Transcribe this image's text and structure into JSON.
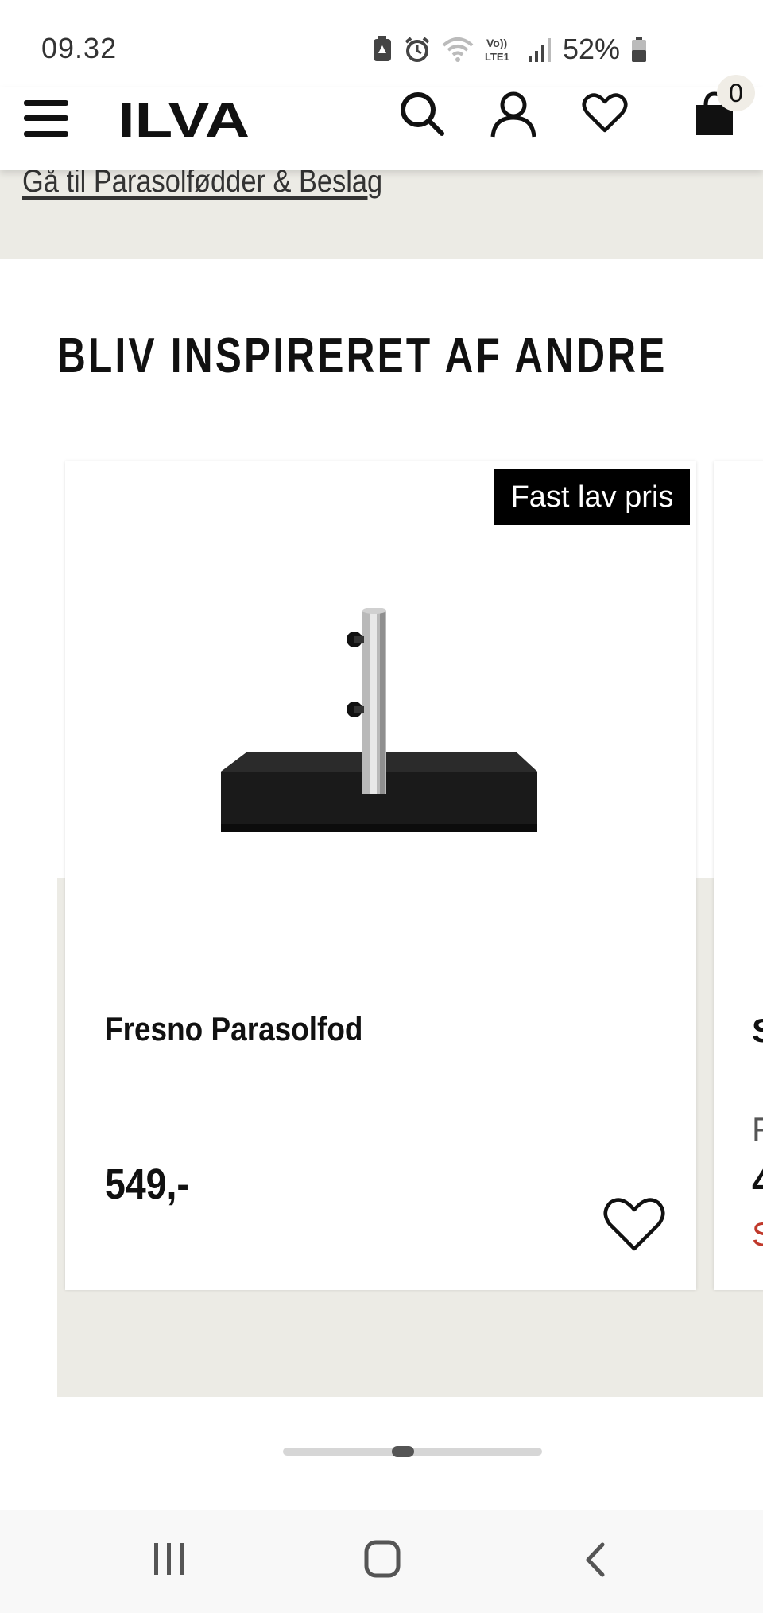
{
  "status_bar": {
    "time": "09.32",
    "battery": "52%",
    "network": "LTE1",
    "icons": [
      "battery-saver-icon",
      "alarm-icon",
      "wifi-icon",
      "volte-icon",
      "signal-icon",
      "battery-icon"
    ]
  },
  "header": {
    "logo": "ILVA",
    "cart_count": "0",
    "icons": [
      "menu-icon",
      "search-icon",
      "user-icon",
      "heart-icon",
      "cart-icon"
    ]
  },
  "top_link": "Gå til Parasolfødder & Beslag",
  "section_title": "BLIV INSPIRERET AF ANDRE",
  "products": [
    {
      "badge": "Fast lav pris",
      "name": "Fresno Parasolfod",
      "price": "549,-"
    }
  ],
  "peek_card": {
    "name_initial": "S",
    "old_price_initial": "F",
    "price_initial": "4",
    "sale_initial": "S"
  },
  "carousel": {
    "position": 0.46
  },
  "nav_bar": {
    "icons": [
      "recent-apps-icon",
      "home-icon",
      "back-icon"
    ]
  }
}
